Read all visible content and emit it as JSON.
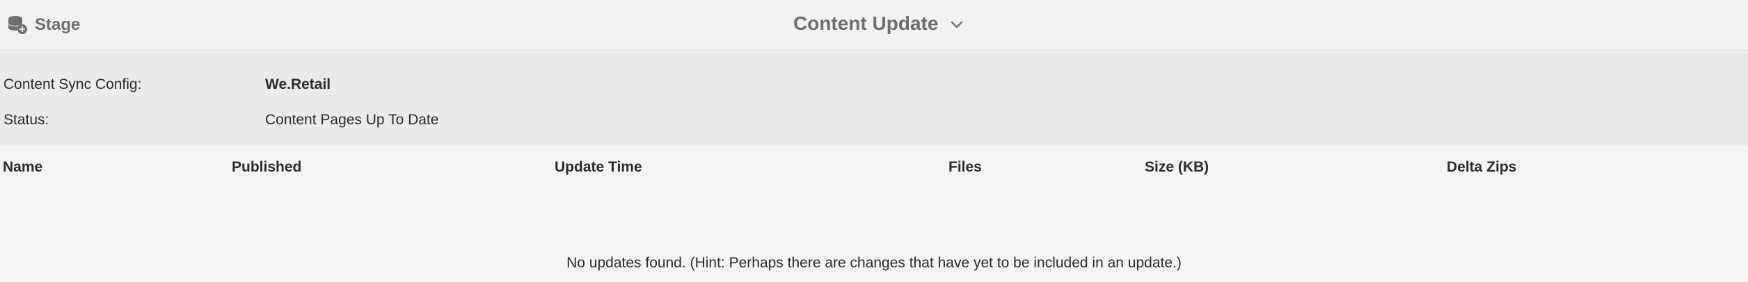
{
  "header": {
    "stage_label": "Stage",
    "stage_icon": "database-add-icon",
    "title": "Content Update",
    "title_icon": "chevron-down-icon"
  },
  "info": {
    "config_label": "Content Sync Config:",
    "config_value": "We.Retail",
    "status_label": "Status:",
    "status_value": "Content Pages Up To Date"
  },
  "table": {
    "columns": [
      "Name",
      "Published",
      "Update Time",
      "Files",
      "Size (KB)",
      "Delta Zips"
    ],
    "rows": [],
    "empty_message": "No updates found. (Hint: Perhaps there are changes that have yet to be included in an update.)"
  },
  "colors": {
    "header_bg": "#f2f2f2",
    "info_bg": "#ebebeb",
    "table_bg": "#f4f4f4",
    "muted_text": "#6e6e6e",
    "text": "#2c2c2c"
  }
}
